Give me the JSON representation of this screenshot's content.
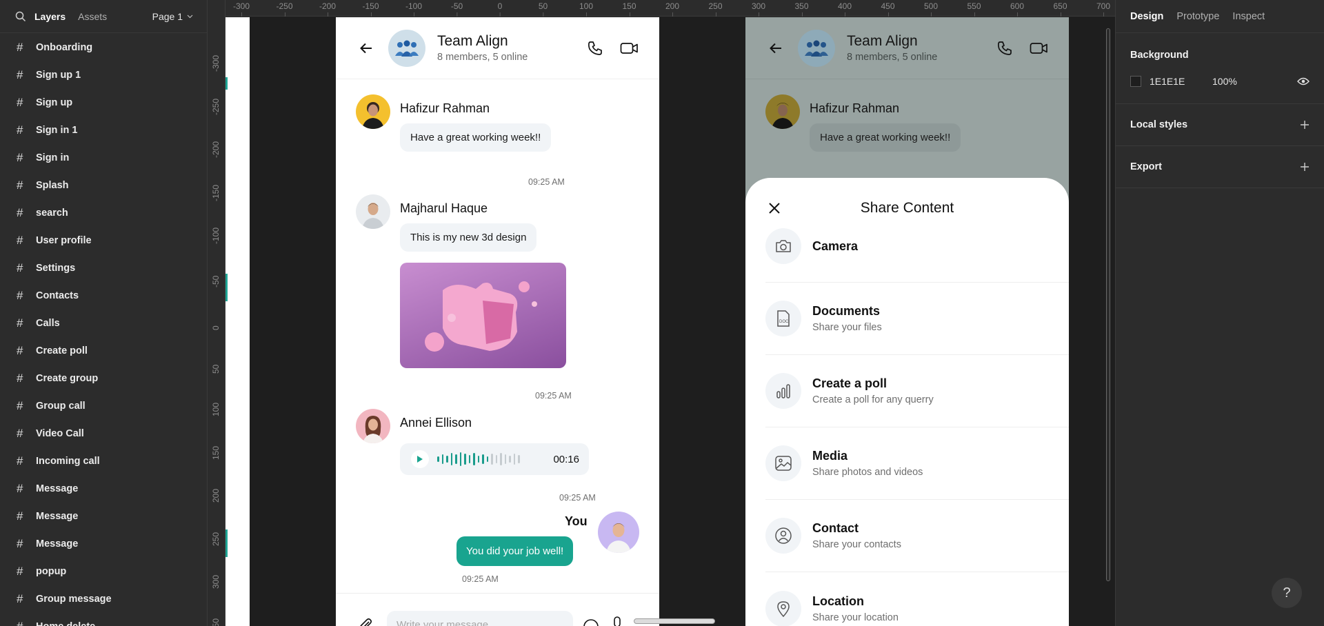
{
  "layers_panel": {
    "tabs": [
      "Layers",
      "Assets"
    ],
    "page_label": "Page 1",
    "items": [
      "Onboarding",
      "Sign up 1",
      "Sign up",
      "Sign in 1",
      "Sign in",
      "Splash",
      "search",
      "User profile",
      "Settings",
      "Contacts",
      "Calls",
      "Create poll",
      "Create group",
      "Group call",
      "Video Call",
      "Incoming call",
      "Message",
      "Message",
      "Message",
      "popup",
      "Group message",
      "Home delete"
    ]
  },
  "ruler": {
    "top": [
      "-300",
      "-250",
      "-200",
      "-150",
      "-100",
      "-50",
      "0",
      "50",
      "100",
      "150",
      "200",
      "250",
      "300",
      "350",
      "400",
      "450",
      "500",
      "550",
      "600",
      "650",
      "700"
    ],
    "left": [
      "-300",
      "-250",
      "-200",
      "-150",
      "-100",
      "-50",
      "0",
      "50",
      "100",
      "150",
      "200",
      "250",
      "300",
      "350"
    ]
  },
  "chat": {
    "title": "Team Align",
    "subtitle": "8 members, 5 online",
    "messages": [
      {
        "sender": "Hafizur Rahman",
        "text": "Have a great working week!!",
        "time": "09:25 AM"
      },
      {
        "sender": "Majharul Haque",
        "text": "This is my new 3d design",
        "time": "09:25 AM"
      },
      {
        "sender": "Annei Ellison",
        "duration": "00:16",
        "time": "09:25 AM"
      },
      {
        "sender": "You",
        "text": "You did your job well!",
        "time": "09:25 AM"
      }
    ],
    "composer_placeholder": "Write your message"
  },
  "share_sheet": {
    "title": "Share Content",
    "options": [
      {
        "label": "Camera",
        "sub": "",
        "icon": "camera-icon"
      },
      {
        "label": "Documents",
        "sub": "Share your files",
        "icon": "document-icon"
      },
      {
        "label": "Create a poll",
        "sub": "Create a poll for any querry",
        "icon": "poll-icon"
      },
      {
        "label": "Media",
        "sub": "Share photos and videos",
        "icon": "image-icon"
      },
      {
        "label": "Contact",
        "sub": "Share your contacts",
        "icon": "contact-icon"
      },
      {
        "label": "Location",
        "sub": "Share your location",
        "icon": "location-icon"
      }
    ]
  },
  "properties_panel": {
    "tabs": [
      "Design",
      "Prototype",
      "Inspect"
    ],
    "background_label": "Background",
    "background_hex": "1E1E1E",
    "background_opacity": "100%",
    "local_styles_label": "Local styles",
    "export_label": "Export",
    "help_label": "?"
  },
  "colors": {
    "accent": "#19a48f",
    "panel": "#2c2c2c",
    "canvas": "#1e1e1e"
  }
}
